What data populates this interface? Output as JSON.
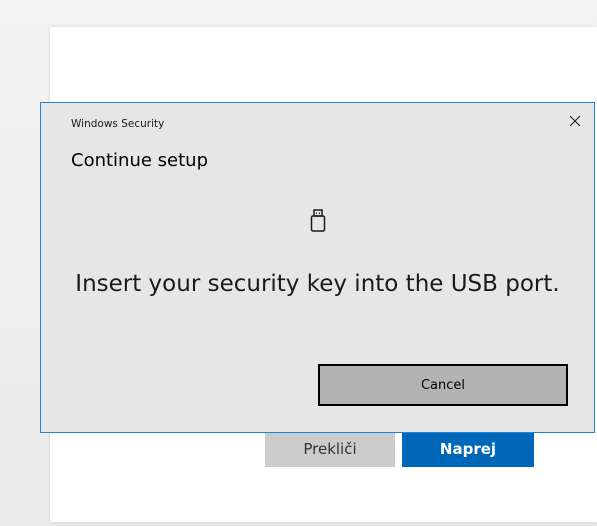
{
  "background_window": {
    "secondary_button": "Prekliči",
    "primary_button": "Naprej",
    "primary_color": "#0067b8"
  },
  "dialog": {
    "app_name": "Windows Security",
    "title": "Continue setup",
    "icon": "usb-key-icon",
    "message": "Insert your security key into the USB port.",
    "cancel_label": "Cancel",
    "close_icon": "close-icon",
    "border_color": "#1f86d8"
  }
}
